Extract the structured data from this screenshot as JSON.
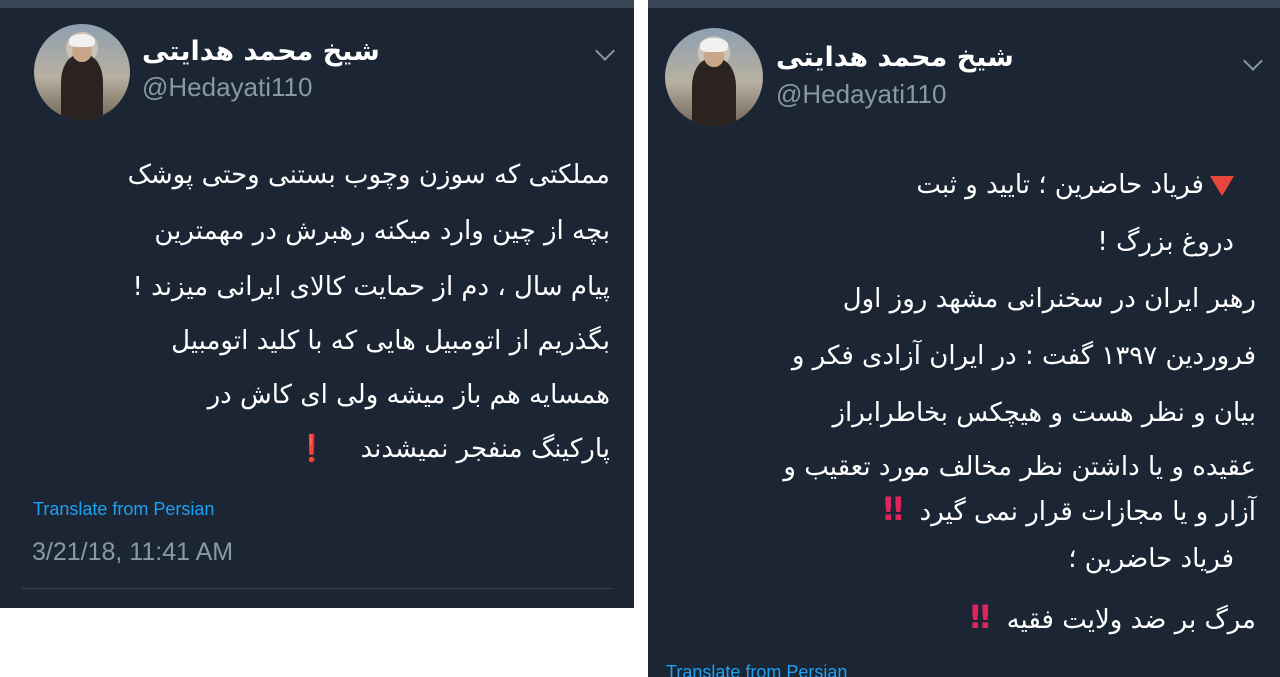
{
  "left_tweet": {
    "display_name": "شیخ محمد هدایتی",
    "handle": "@Hedayati110",
    "lines": [
      "مملکتی که سوزن وچوب بستنی وحتی پوشک",
      "بچه از چین وارد میکنه رهبرش در مهمترین",
      "پیام سال ، دم از حمایت کالای ایرانی میزند !",
      "بگذریم از اتومبیل هایی که با کلید اتومبیل",
      "همسایه هم باز میشه ولی ای کاش در",
      "پارکینگ منفجر نمیشدند"
    ],
    "last_line_mark": "❗",
    "translate_label": "Translate from Persian",
    "timestamp": "3/21/18, 11:41 AM"
  },
  "right_tweet": {
    "display_name": "شیخ محمد هدایتی",
    "handle": "@Hedayati110",
    "lines": [
      "فریاد حاضرین ؛ تایید و ثبت",
      "دروغ بزرگ !",
      "رهبر ایران در سخنرانی مشهد روز اول",
      "فروردین ۱۳۹۷ گفت : در ایران آزادی فکر و",
      "بیان و نظر هست و هیچکس بخاطرابراز",
      "عقیده و یا داشتن نظر مخالف مورد تعقیب و",
      "آزار و یا   مجازات قرار نمی گیرد",
      "فریاد حاضرین ؛",
      "مرگ بر  ضد ولایت فقیه"
    ],
    "line7_mark": "‼",
    "line9_mark": "‼",
    "translate_label": "Translate from Persian"
  },
  "colors": {
    "tweet_bg": "#1b2533",
    "link": "#1da1f2",
    "muted": "#8899a6",
    "alert_red": "#e0245e"
  },
  "icons": [
    "avatar",
    "chevron-down-icon",
    "red-triangle-icon",
    "exclamation-icon",
    "double-exclamation-icon"
  ]
}
